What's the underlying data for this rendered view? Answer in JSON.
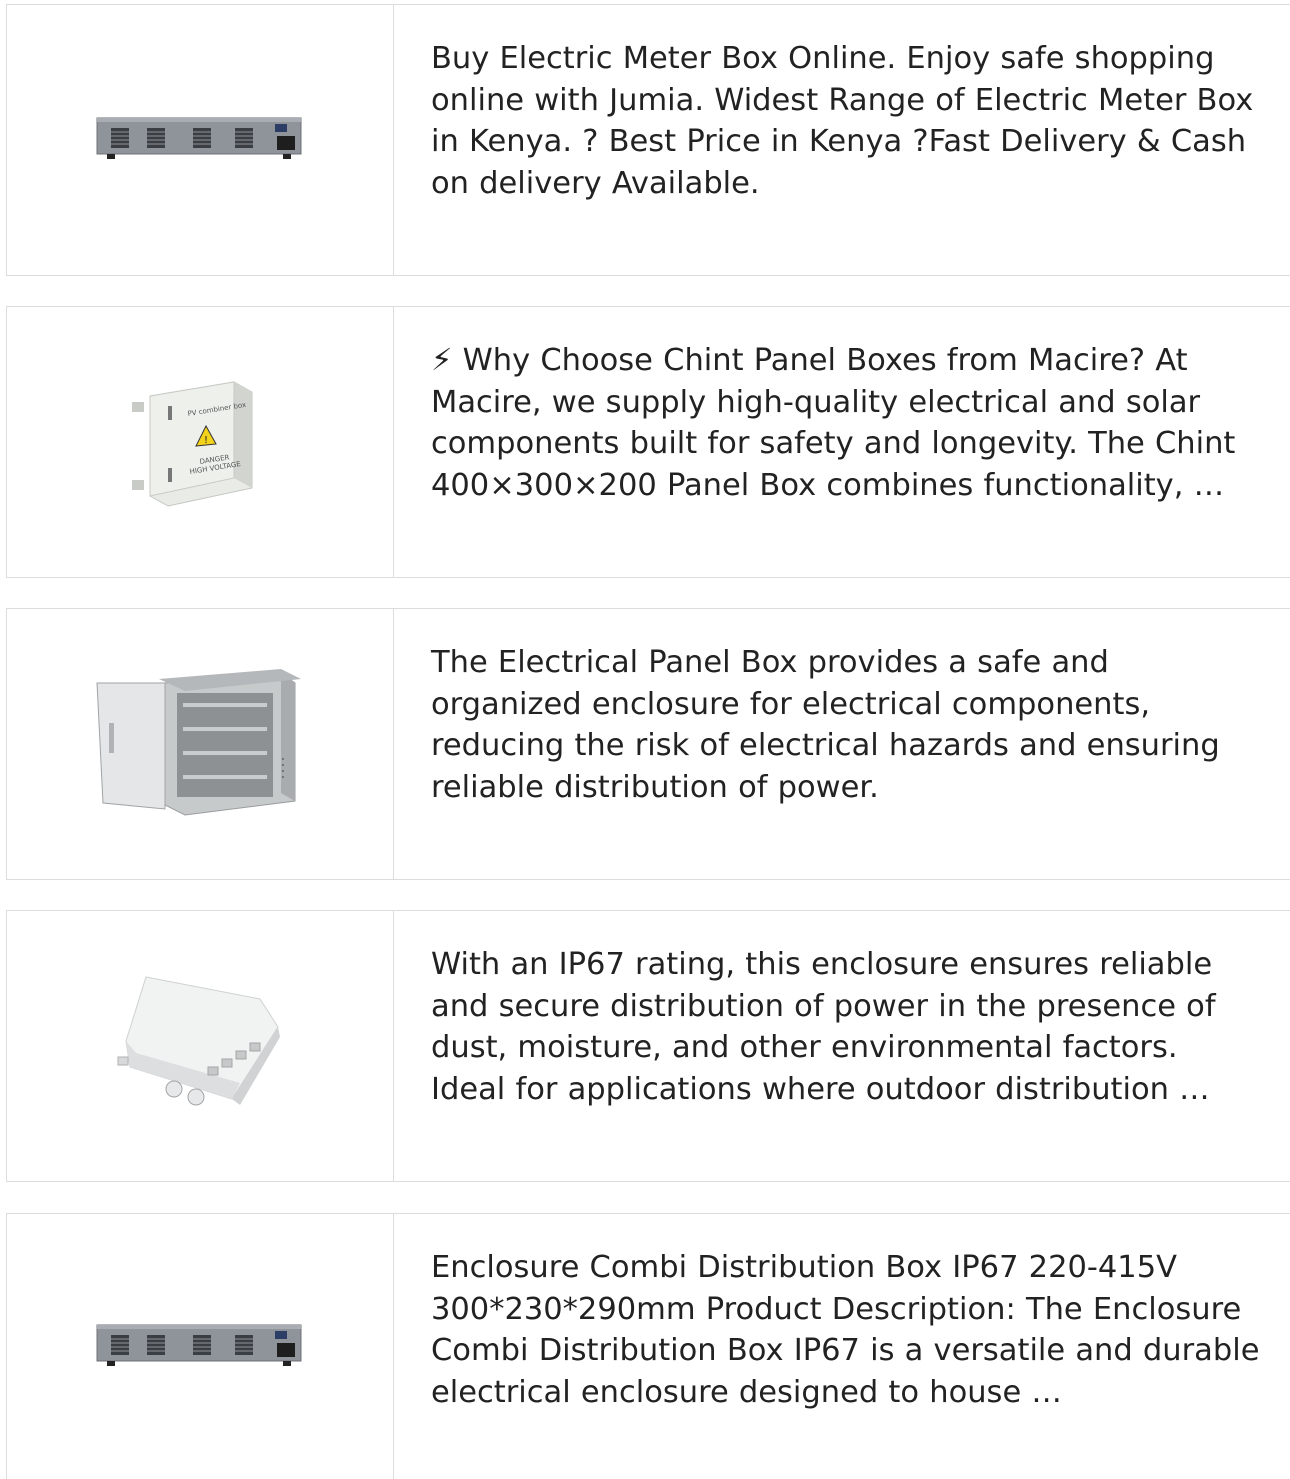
{
  "products": [
    {
      "image_name": "desktop-power-supply-unit",
      "description": "Buy Electric Meter Box Online. Enjoy safe shopping online with Jumia. Widest Range of Electric Meter Box in Kenya. ? Best Price in Kenya ?Fast Delivery & Cash on delivery Available."
    },
    {
      "image_name": "pv-combiner-box",
      "image_text": [
        "PV combiner box",
        "DANGER",
        "HIGH VOLTAGE"
      ],
      "description": "⚡ Why Choose Chint Panel Boxes from Macire? At Macire, we supply high-quality electrical and solar components built for safety and longevity. The Chint 400×300×200 Panel Box combines functionality, …"
    },
    {
      "image_name": "stainless-outdoor-cabinet",
      "description": "The Electrical Panel Box provides a safe and organized enclosure for electrical components, reducing the risk of electrical hazards and ensuring reliable distribution of power."
    },
    {
      "image_name": "ip67-outdoor-enclosure",
      "description": "With an IP67 rating, this enclosure ensures reliable and secure distribution of power in the presence of dust, moisture, and other environmental factors. Ideal for applications where outdoor distribution …"
    },
    {
      "image_name": "desktop-power-supply-unit",
      "description": "Enclosure Combi Distribution Box IP67 220-415V 300*230*290mm Product Description: The Enclosure Combi Distribution Box IP67 is a versatile and durable electrical enclosure designed to house …"
    }
  ]
}
